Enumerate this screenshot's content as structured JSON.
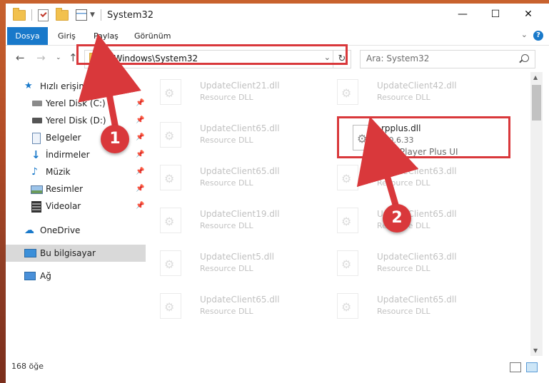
{
  "window": {
    "title": "System32",
    "minimize_glyph": "—",
    "maximize_glyph": "☐",
    "close_glyph": "✕"
  },
  "ribbon": {
    "tabs": [
      "Dosya",
      "Giriş",
      "Paylaş",
      "Görünüm"
    ]
  },
  "address_bar": {
    "path": "C:\\Windows\\System32"
  },
  "search": {
    "placeholder": "Ara: System32"
  },
  "sidebar": {
    "quick_access": "Hızlı erişim",
    "items": [
      {
        "label": "Yerel Disk (C:)",
        "icon": "drive-icon",
        "pinned": true
      },
      {
        "label": "Yerel Disk (D:)",
        "icon": "drive-icon",
        "pinned": true
      },
      {
        "label": "Belgeler",
        "icon": "documents-icon",
        "pinned": true
      },
      {
        "label": "İndirmeler",
        "icon": "download-icon",
        "pinned": true
      },
      {
        "label": "Müzik",
        "icon": "music-icon",
        "pinned": true
      },
      {
        "label": "Resimler",
        "icon": "pictures-icon",
        "pinned": true
      },
      {
        "label": "Videolar",
        "icon": "videos-icon",
        "pinned": true
      }
    ],
    "onedrive": "OneDrive",
    "this_pc": "Bu bilgisayar",
    "network": "Ağ"
  },
  "files": [
    {
      "name": "UpdateClient21.dll",
      "desc": "Resource DLL"
    },
    {
      "name": "UpdateClient42.dll",
      "desc": "Resource DLL"
    },
    {
      "name": "UpdateClient65.dll",
      "desc": "Resource DLL"
    },
    {
      "name": "rpplus.dll",
      "version": "6.0.6.33",
      "desc": "RealPlayer Plus UI"
    },
    {
      "name": "UpdateClient65.dll",
      "desc": "Resource DLL"
    },
    {
      "name": "UpdateClient63.dll",
      "desc": "Resource DLL"
    },
    {
      "name": "UpdateClient19.dll",
      "desc": "Resource DLL"
    },
    {
      "name": "UpdateClient65.dll",
      "desc": "Resource DLL"
    },
    {
      "name": "UpdateClient5.dll",
      "desc": "Resource DLL"
    },
    {
      "name": "UpdateClient63.dll",
      "desc": "Resource DLL"
    },
    {
      "name": "UpdateClient65.dll",
      "desc": "Resource DLL"
    },
    {
      "name": "UpdateClient65.dll",
      "desc": "Resource DLL"
    }
  ],
  "status": {
    "count": "168 öğe"
  },
  "callouts": [
    "1",
    "2"
  ],
  "colors": {
    "accent": "#1979ca",
    "highlight": "#d9383b"
  }
}
